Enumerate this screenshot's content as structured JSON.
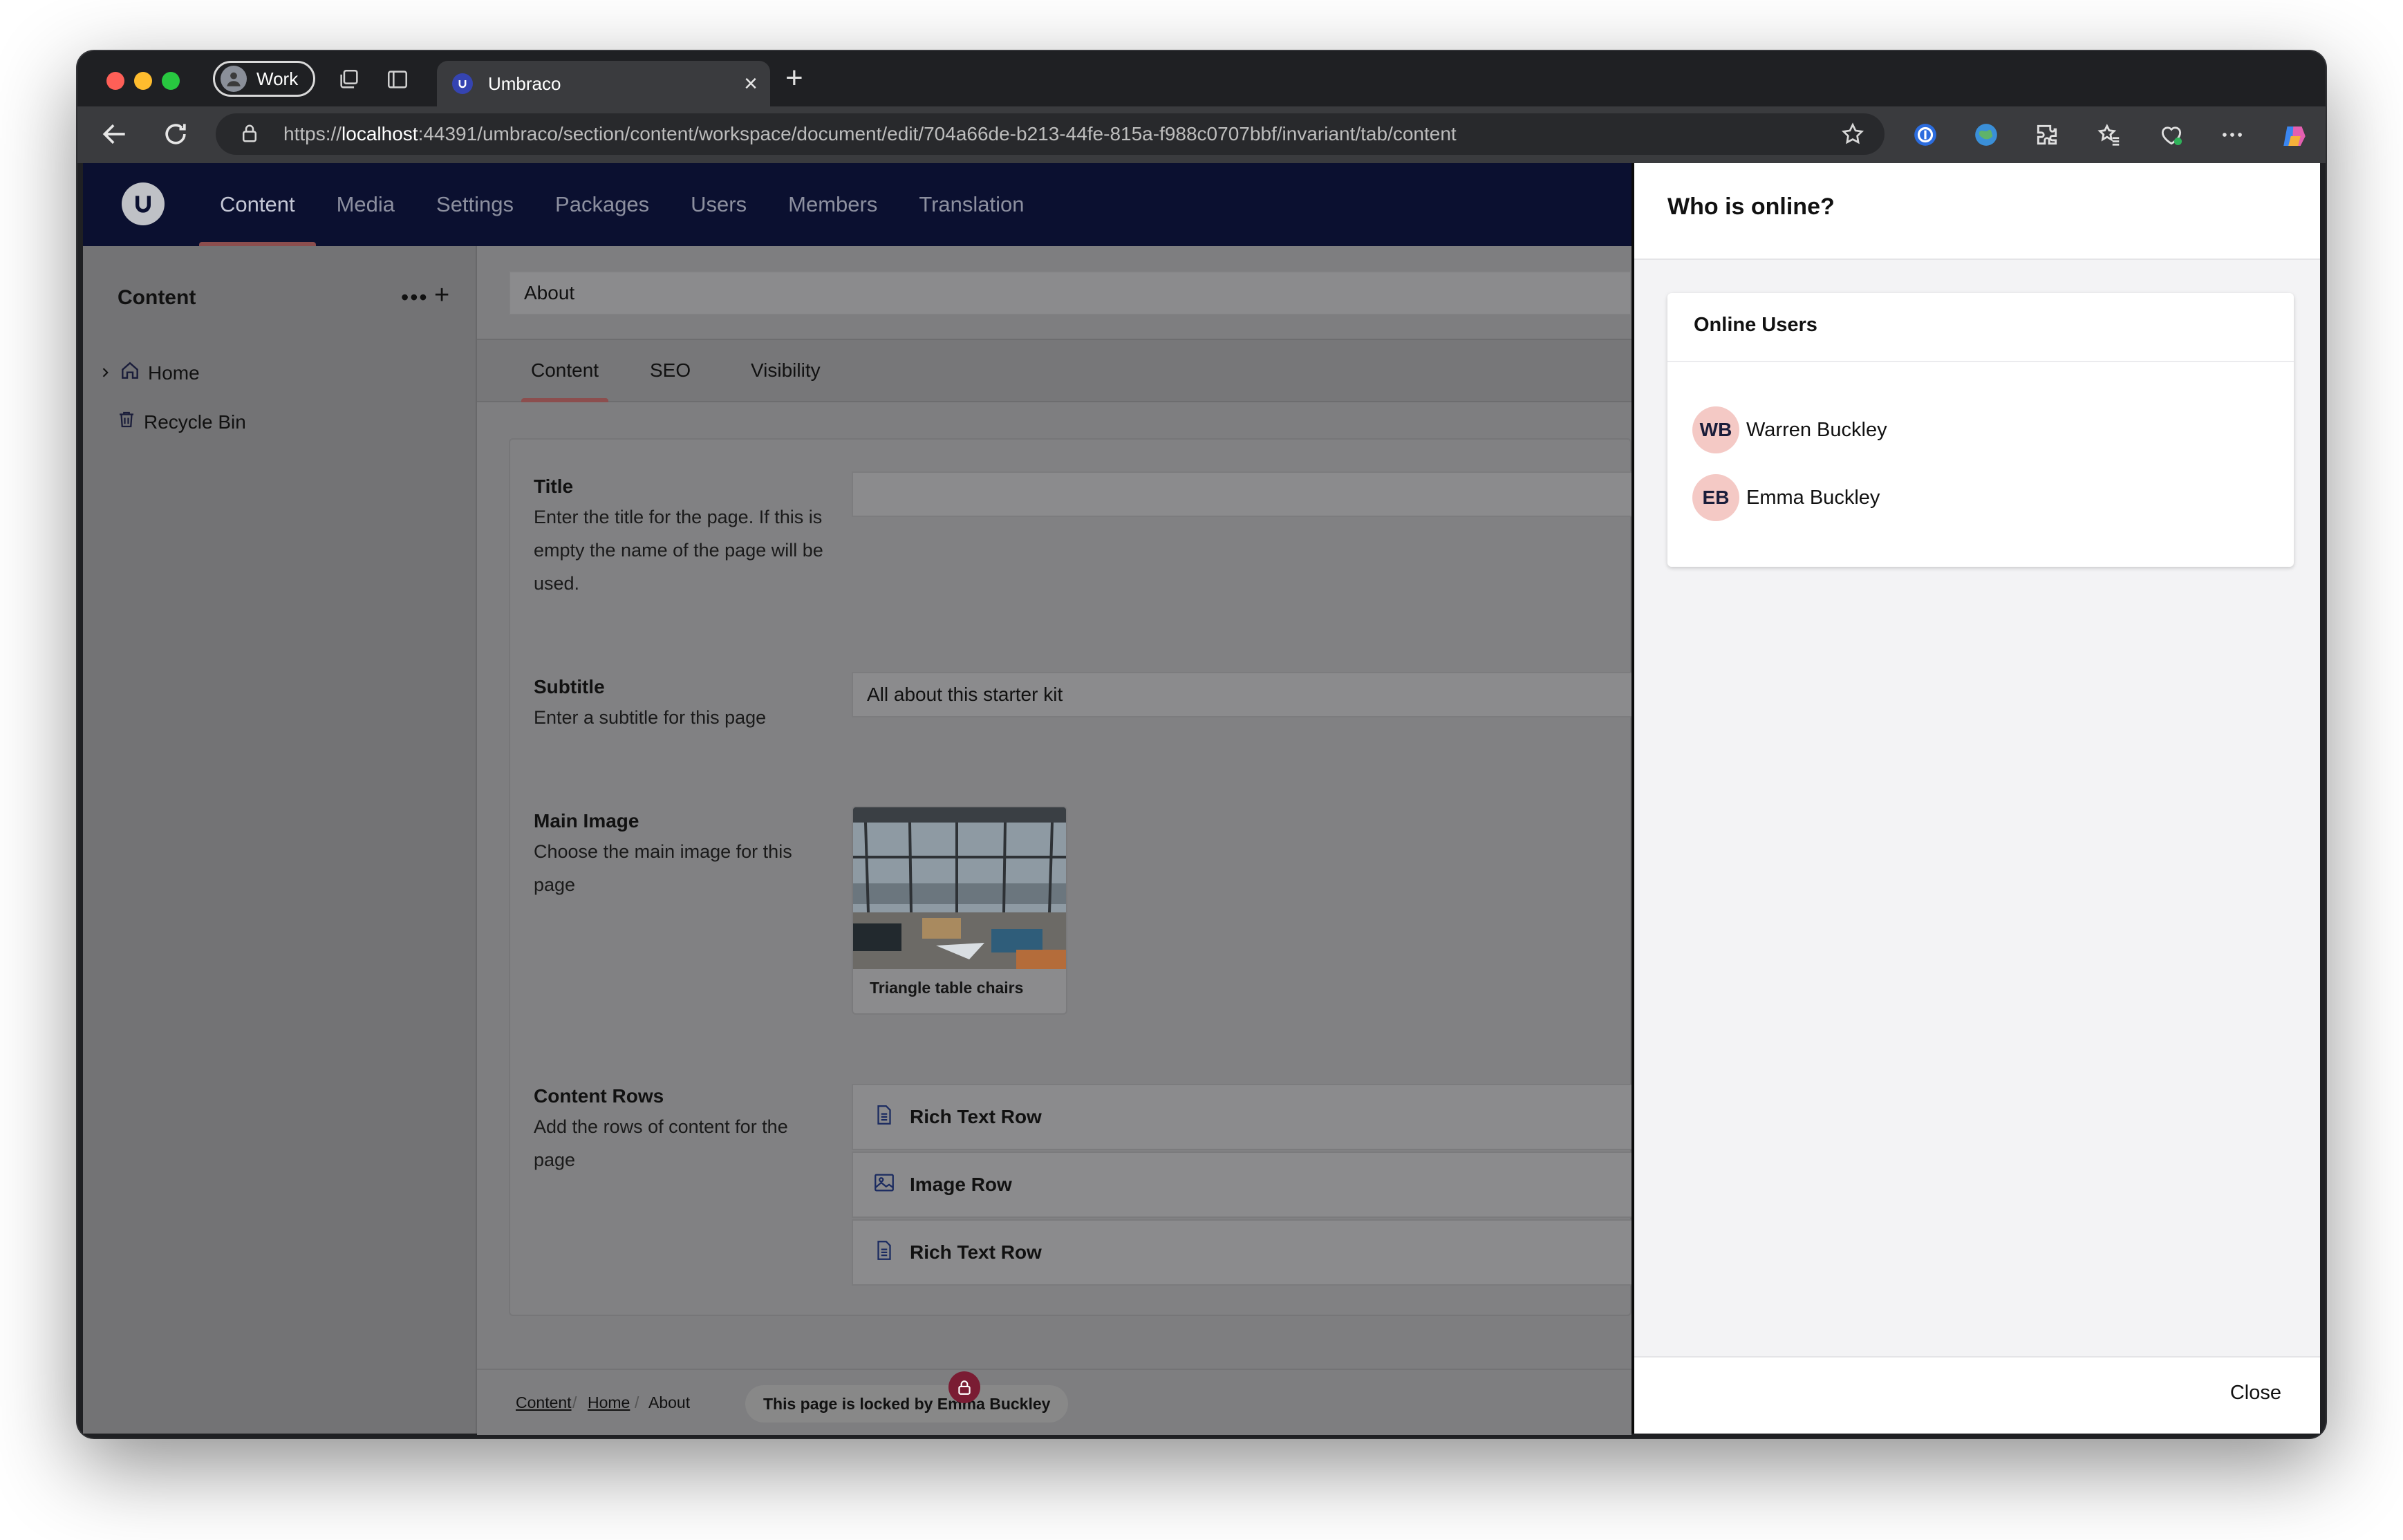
{
  "browser": {
    "profile_label": "Work",
    "tab_title": "Umbraco",
    "url_scheme": "https://",
    "url_host": "localhost",
    "url_rest": ":44391/umbraco/section/content/workspace/document/edit/704a66de-b213-44fe-815a-f988c0707bbf/invariant/tab/content"
  },
  "header": {
    "sections": [
      "Content",
      "Media",
      "Settings",
      "Packages",
      "Users",
      "Members",
      "Translation"
    ],
    "active_section": "Content"
  },
  "sidebar": {
    "title": "Content",
    "more": "•••",
    "add": "+",
    "items": [
      {
        "label": "Home",
        "icon": "home-icon"
      },
      {
        "label": "Recycle Bin",
        "icon": "trash-icon"
      }
    ]
  },
  "document": {
    "name": "About",
    "tabs": [
      "Content",
      "SEO",
      "Visibility"
    ],
    "active_tab": "Content",
    "properties": {
      "title": {
        "label": "Title",
        "description": "Enter the title for the page. If this is empty the name of the page will be used.",
        "value": ""
      },
      "subtitle": {
        "label": "Subtitle",
        "description": "Enter a subtitle for this page",
        "value": "All about this starter kit"
      },
      "main_image": {
        "label": "Main Image",
        "description": "Choose the main image for this page",
        "caption": "Triangle table chairs"
      },
      "content_rows": {
        "label": "Content Rows",
        "description": "Add the rows of content for the page",
        "blocks": [
          {
            "label": "Rich Text Row",
            "icon": "document-icon"
          },
          {
            "label": "Image Row",
            "icon": "picture-icon"
          },
          {
            "label": "Rich Text Row",
            "icon": "document-icon"
          }
        ]
      }
    }
  },
  "footer": {
    "breadcrumb": [
      "Content",
      "Home",
      "About"
    ],
    "lock_message": "This page is locked by Emma Buckley"
  },
  "dialog": {
    "title": "Who is online?",
    "card_title": "Online Users",
    "users": [
      {
        "initials": "WB",
        "name": "Warren Buckley"
      },
      {
        "initials": "EB",
        "name": "Emma Buckley"
      }
    ],
    "close_label": "Close"
  },
  "colors": {
    "header_bg": "#0b1030",
    "active_indicator": "#8c4e4e",
    "avatar_bg": "#f4c9c5",
    "lock_badge": "#7a1c33"
  }
}
